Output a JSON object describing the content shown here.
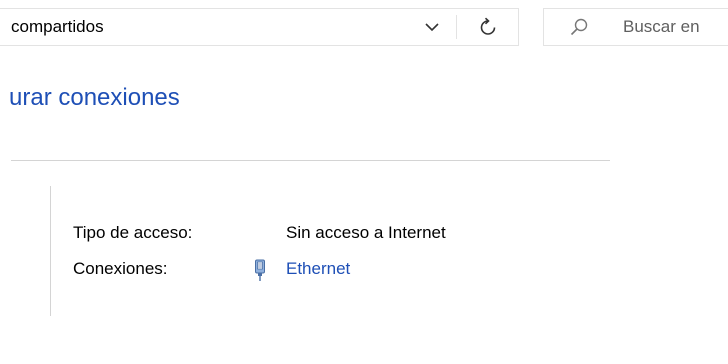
{
  "address_bar": {
    "path_text": "compartidos"
  },
  "search": {
    "placeholder": "Buscar en"
  },
  "content": {
    "task_link": "urar conexiones",
    "network": {
      "access_label": "Tipo de acceso:",
      "access_value": "Sin acceso a Internet",
      "connections_label": "Conexiones:",
      "connections_value": "Ethernet"
    }
  },
  "icons": {
    "dropdown": "chevron-down-icon",
    "refresh": "refresh-icon",
    "search": "search-icon",
    "connection": "ethernet-icon"
  },
  "colors": {
    "link": "#1e4fb6",
    "border": "#e3e3e3",
    "divider": "#d4d4d4",
    "icon_fill": "#6b8fc7"
  }
}
